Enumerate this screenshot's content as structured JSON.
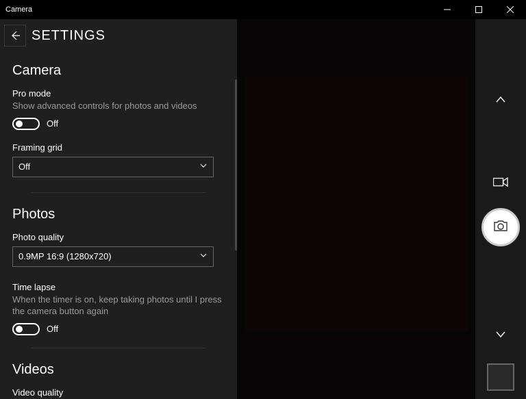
{
  "titlebar": {
    "title": "Camera"
  },
  "settings": {
    "title": "SETTINGS",
    "sections": {
      "camera": {
        "heading": "Camera",
        "pro_mode": {
          "label": "Pro mode",
          "desc": "Show advanced controls for photos and videos",
          "state": "Off"
        },
        "framing_grid": {
          "label": "Framing grid",
          "value": "Off"
        }
      },
      "photos": {
        "heading": "Photos",
        "quality": {
          "label": "Photo quality",
          "value": "0.9MP 16:9 (1280x720)"
        },
        "time_lapse": {
          "label": "Time lapse",
          "desc": "When the timer is on, keep taking photos until I press the camera button again",
          "state": "Off"
        }
      },
      "videos": {
        "heading": "Videos",
        "quality": {
          "label": "Video quality"
        }
      }
    }
  }
}
